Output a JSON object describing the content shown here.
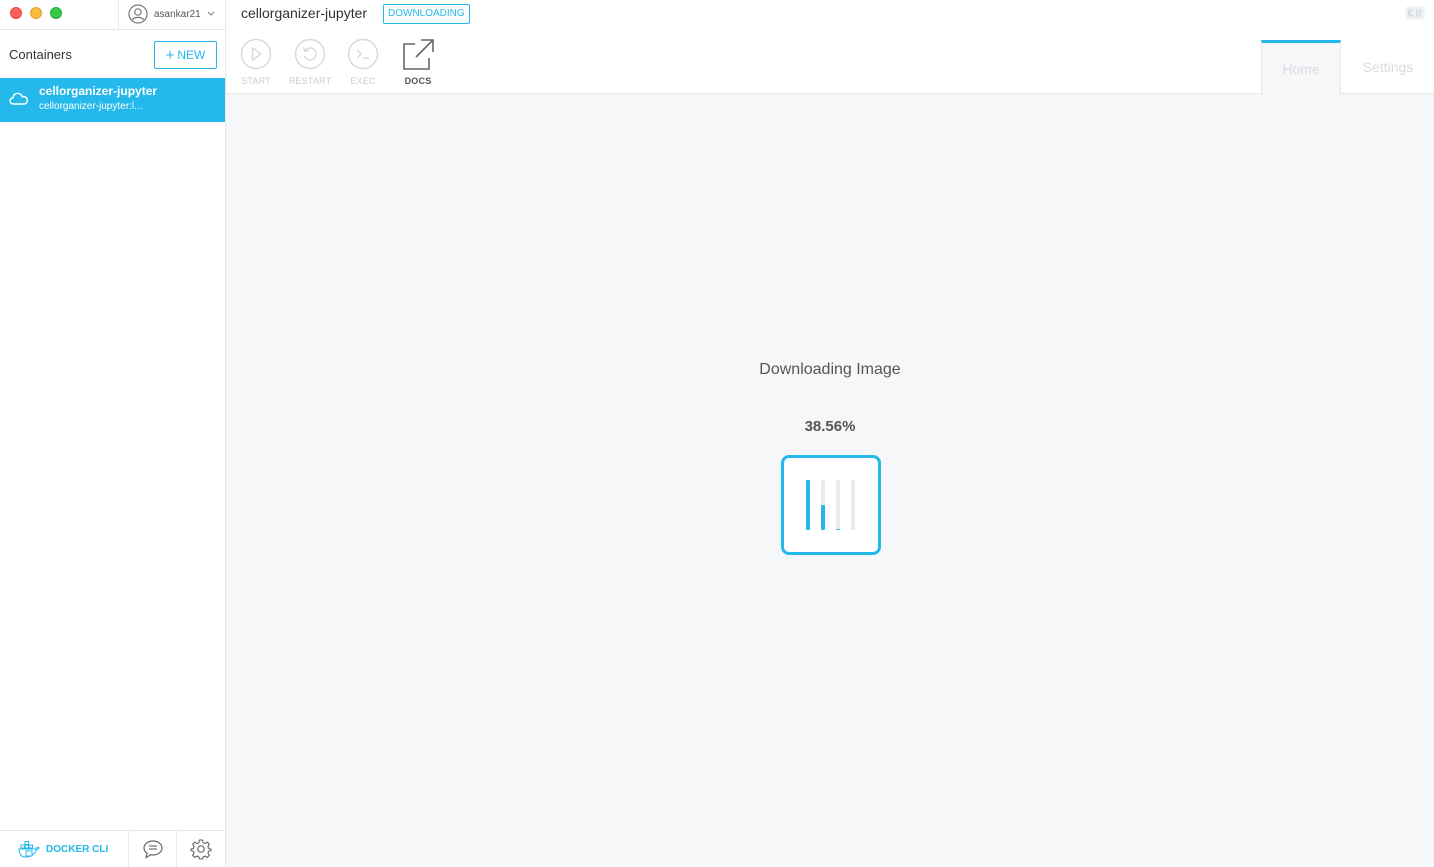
{
  "titlebar": {
    "account_name": "asankar21",
    "account_icon": "user-circle-icon",
    "account_dropdown_icon": "chevron-down-icon"
  },
  "sidebar": {
    "containers_title": "Containers",
    "new_button_label": "NEW",
    "containers": [
      {
        "name": "cellorganizer-jupyter",
        "subtitle": "cellorganizer-jupyter:l...",
        "icon": "cloud-icon",
        "selected": true
      }
    ],
    "footer": {
      "docker_cli_label": "DOCKER CLI",
      "docker_cli_icon": "docker-whale-icon",
      "feedback_icon": "chat-bubble-icon",
      "settings_icon": "gear-icon"
    }
  },
  "header": {
    "container_title": "cellorganizer-jupyter",
    "status_badge": "DOWNLOADING",
    "logo": "kitematic-logo",
    "actions": [
      {
        "label": "START",
        "icon": "play-icon",
        "enabled": false
      },
      {
        "label": "RESTART",
        "icon": "restart-icon",
        "enabled": false
      },
      {
        "label": "EXEC",
        "icon": "terminal-icon",
        "enabled": false
      },
      {
        "label": "DOCS",
        "icon": "external-link-icon",
        "enabled": true
      }
    ],
    "tabs": [
      {
        "label": "Home",
        "active": true
      },
      {
        "label": "Settings",
        "active": false
      }
    ]
  },
  "main": {
    "download_title": "Downloading Image",
    "download_percent": "38.56%",
    "layer_progress": [
      1.0,
      0.5,
      0.02,
      0.0
    ]
  },
  "colors": {
    "accent": "#24b8eb",
    "background": "#f6f7f9",
    "disabled": "#c9ccd1"
  }
}
